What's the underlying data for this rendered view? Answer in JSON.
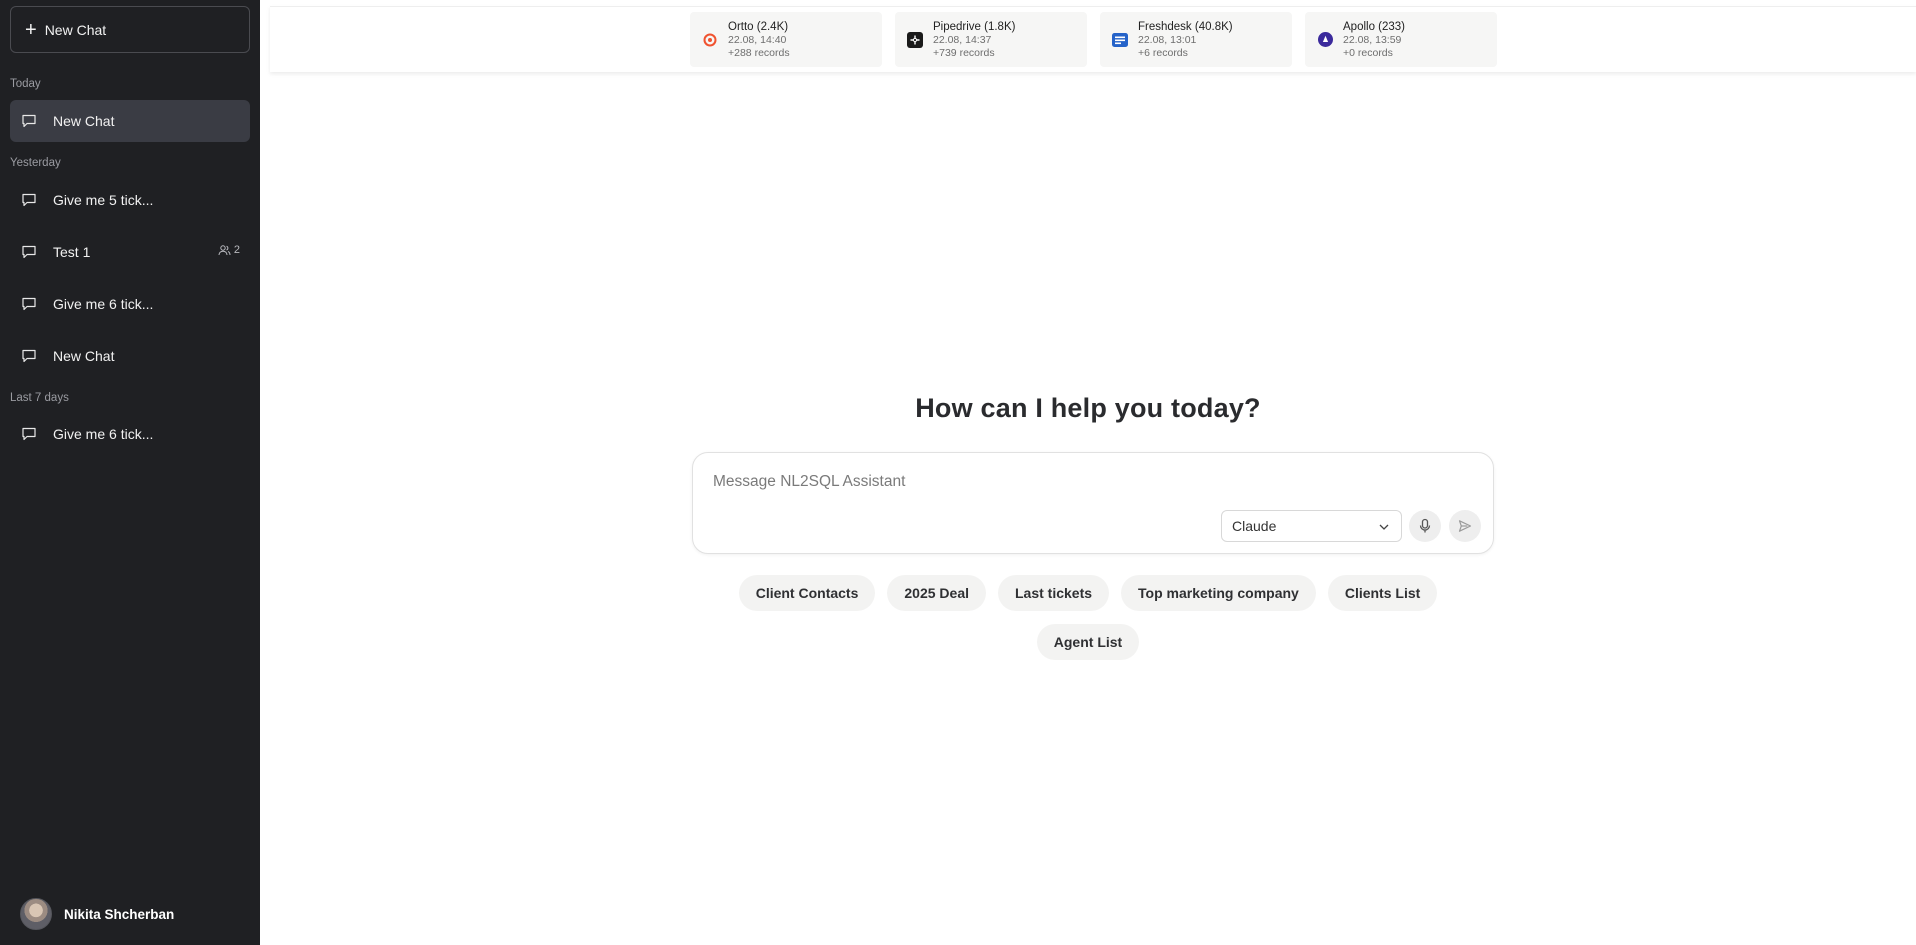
{
  "sidebar": {
    "new_chat_label": "New Chat",
    "groups": {
      "today": "Today",
      "yesterday": "Yesterday",
      "last7": "Last 7 days"
    },
    "chats": [
      {
        "label": "New Chat",
        "active": true
      },
      {
        "label": "Give me 5 tick..."
      },
      {
        "label": "Test 1",
        "shared_count": "2"
      },
      {
        "label": "Give me 6 tick..."
      },
      {
        "label": "New Chat"
      },
      {
        "label": "Give me 6 tick..."
      }
    ],
    "user": {
      "name": "Nikita Shcherban"
    }
  },
  "sources": [
    {
      "name": "Ortto (2.4K)",
      "time": "22.08, 14:40",
      "records": "+288 records",
      "icon": "ortto-icon",
      "color": "#f0522f"
    },
    {
      "name": "Pipedrive (1.8K)",
      "time": "22.08, 14:37",
      "records": "+739 records",
      "icon": "pipedrive-icon",
      "color": "#1a1a1a"
    },
    {
      "name": "Freshdesk (40.8K)",
      "time": "22.08, 13:01",
      "records": "+6 records",
      "icon": "freshdesk-icon",
      "color": "#2563c9"
    },
    {
      "name": "Apollo (233)",
      "time": "22.08, 13:59",
      "records": "+0 records",
      "icon": "apollo-icon",
      "color": "#3b2a9c"
    }
  ],
  "main": {
    "title": "How can I help you today?",
    "input_placeholder": "Message NL2SQL Assistant",
    "model": "Claude",
    "suggestions": [
      "Client Contacts",
      "2025 Deal",
      "Last tickets",
      "Top marketing company",
      "Clients List",
      "Agent List"
    ]
  }
}
